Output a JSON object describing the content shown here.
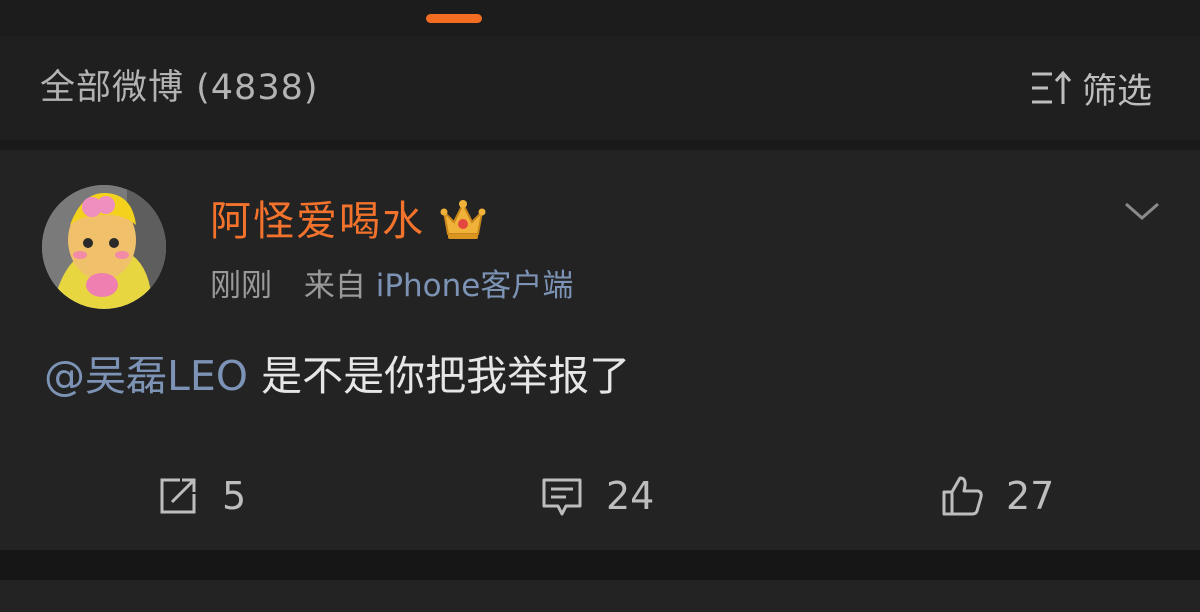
{
  "filter_bar": {
    "all_posts_label": "全部微博 (4838)",
    "filter_label": "筛选",
    "filter_icon": "filter-sort-icon"
  },
  "tab_indicator_color": "#f26d22",
  "post": {
    "username": "阿怪爱喝水",
    "username_color": "#f3732c",
    "badge_icon": "crown-icon",
    "time": "刚刚",
    "source_prefix": "来自",
    "source": "iPhone客户端",
    "mention": "@吴磊LEO",
    "text": " 是不是你把我举报了",
    "menu_icon": "chevron-down-icon"
  },
  "actions": {
    "repost": {
      "icon": "share-icon",
      "count": "5"
    },
    "comment": {
      "icon": "comment-icon",
      "count": "24"
    },
    "like": {
      "icon": "thumbs-up-icon",
      "count": "27"
    }
  },
  "colors": {
    "background": "#1a1a1a",
    "card": "#232323",
    "link": "#7c93b5"
  }
}
